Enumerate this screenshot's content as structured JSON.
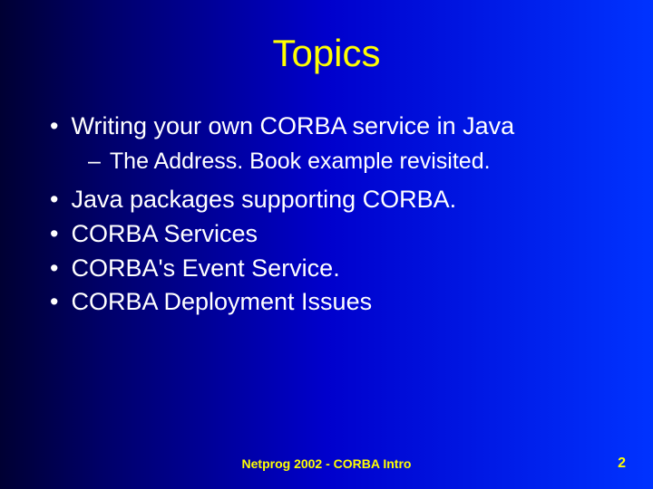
{
  "title": "Topics",
  "bullets": [
    {
      "text": "Writing your own CORBA service in Java",
      "sub": "The Address. Book example revisited."
    },
    {
      "text": "Java packages supporting CORBA."
    },
    {
      "text": "CORBA Services"
    },
    {
      "text": "CORBA's Event Service."
    },
    {
      "text": "CORBA Deployment Issues"
    }
  ],
  "footer": {
    "center": "Netprog 2002  -  CORBA Intro",
    "page": "2"
  }
}
